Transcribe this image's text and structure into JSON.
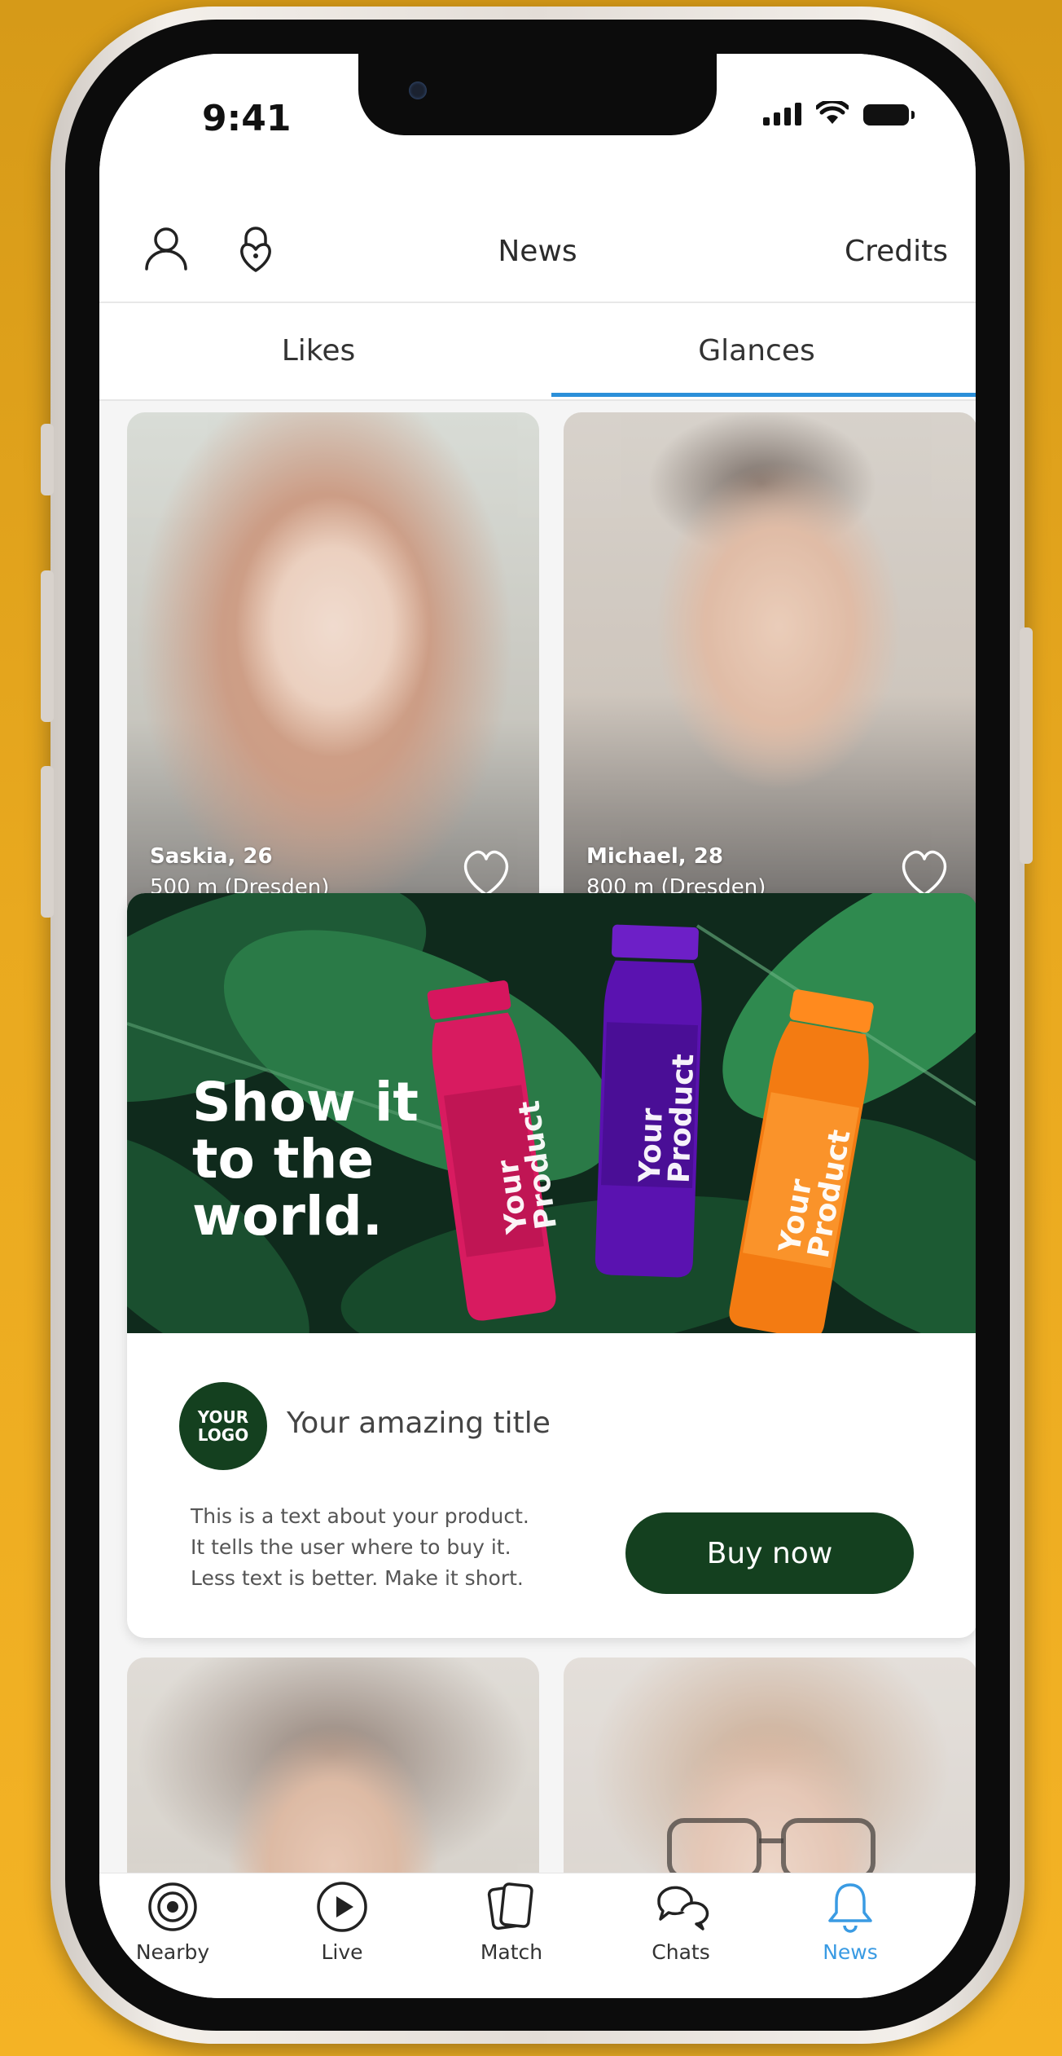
{
  "status_bar": {
    "time": "9:41"
  },
  "header": {
    "profile_icon": "person-icon",
    "privacy_icon": "lock-heart-icon",
    "title": "News",
    "credits_label": "Credits"
  },
  "tabs": [
    {
      "label": "Likes",
      "active": false
    },
    {
      "label": "Glances",
      "active": true
    }
  ],
  "profiles": [
    {
      "name": "Saskia, 26",
      "distance": "500 m (Dresden)"
    },
    {
      "name": "Michael, 28",
      "distance": "800 m (Dresden)"
    }
  ],
  "ad": {
    "headline": "Show it\nto the\nworld.",
    "bottle_label": "Your\nProduct",
    "logo_text": "YOUR\nLOGO",
    "title": "Your amazing title",
    "body": "This is a text about your product.\nIt tells the user where to buy it.\nLess text is better. Make it short.",
    "cta_label": "Buy now"
  },
  "nav": [
    {
      "label": "Nearby",
      "icon": "radar-icon"
    },
    {
      "label": "Live",
      "icon": "play-circle-icon"
    },
    {
      "label": "Match",
      "icon": "cards-icon"
    },
    {
      "label": "Chats",
      "icon": "chat-bubbles-icon"
    },
    {
      "label": "News",
      "icon": "bell-icon",
      "active": true
    }
  ],
  "colors": {
    "accent": "#2b8fd9",
    "nav_active": "#3a9be3",
    "cta": "#14401f",
    "background": "#e9a91f"
  }
}
